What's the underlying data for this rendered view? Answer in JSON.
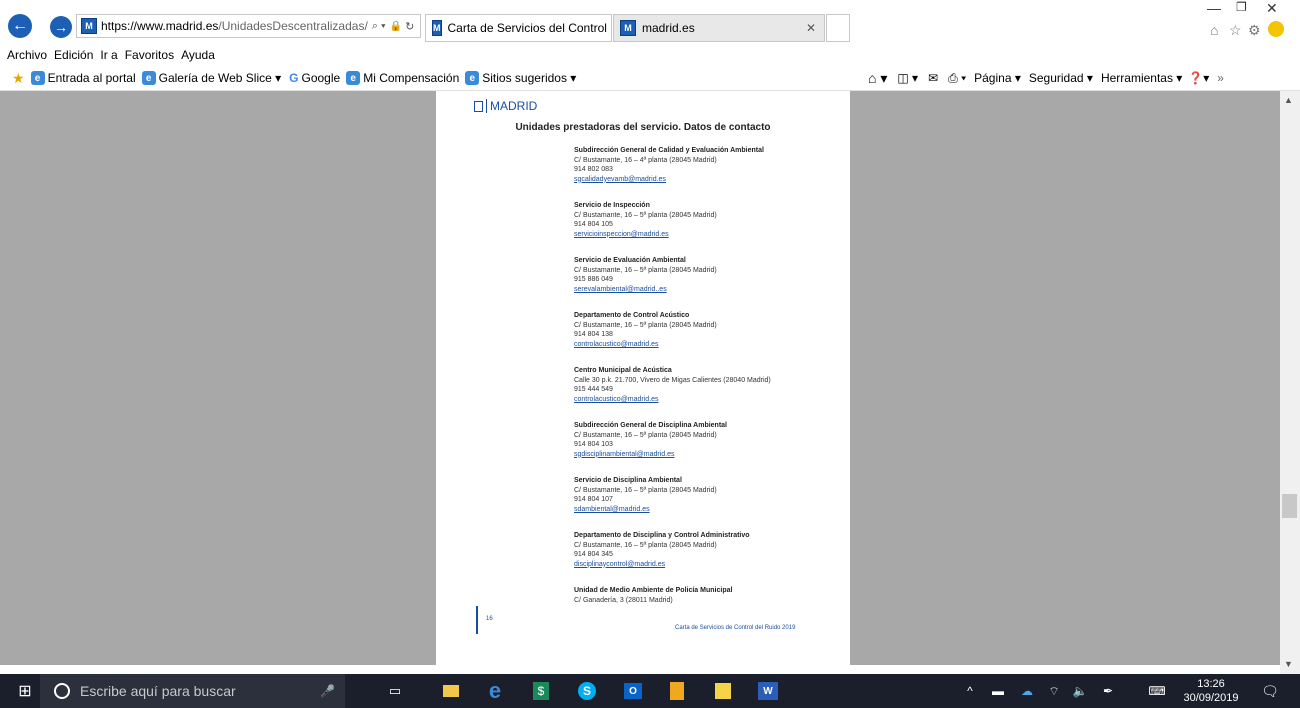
{
  "browser": {
    "url_host": "https://www.madrid.es",
    "url_path": "/UnidadesDescentralizadas/",
    "tabs": [
      {
        "label": "Carta de Servicios del Control ..."
      },
      {
        "label": "madrid.es"
      }
    ],
    "favicon_letter": "M"
  },
  "menu": [
    "Archivo",
    "Edición",
    "Ir a",
    "Favoritos",
    "Ayuda"
  ],
  "favorites": [
    {
      "label": "Entrada al portal"
    },
    {
      "label": "Galería de Web Slice ▾"
    },
    {
      "label": "Google"
    },
    {
      "label": "Mi Compensación"
    },
    {
      "label": "Sitios sugeridos ▾"
    }
  ],
  "commandbar": {
    "page": "Página ▾",
    "security": "Seguridad ▾",
    "tools": "Herramientas ▾"
  },
  "document": {
    "logo": "MADRID",
    "heading": "Unidades prestadoras del servicio. Datos de contacto",
    "entries": [
      {
        "title": "Subdirección General de Calidad y Evaluación Ambiental",
        "address": "C/ Bustamante, 16 – 4ª planta (28045 Madrid)",
        "phone": "914 802 083",
        "email": "sgcalidadyevamb@madrid.es"
      },
      {
        "title": "Servicio de Inspección",
        "address": "C/ Bustamante, 16 – 5ª planta (28045 Madrid)",
        "phone": "914 804 105",
        "email": "servicioinspeccion@madrid.es"
      },
      {
        "title": "Servicio de Evaluación Ambiental",
        "address": "C/ Bustamante, 16 – 5ª planta (28045 Madrid)",
        "phone": "915 886 049",
        "email": "serevalambiental@madrid..es"
      },
      {
        "title": "Departamento de Control Acústico",
        "address": "C/ Bustamante, 16 – 5ª planta (28045 Madrid)",
        "phone": "914 804 138",
        "email": "controlacustico@madrid.es"
      },
      {
        "title": "Centro Municipal de Acústica",
        "address": "Calle 30  p.k. 21.700, Vivero de Migas Calientes (28040 Madrid)",
        "phone": "915 444 549",
        "email": "controlacustico@madrid.es"
      },
      {
        "title": "Subdirección General de Disciplina Ambiental",
        "address": "C/ Bustamante, 16 – 5ª planta (28045 Madrid)",
        "phone": "914 804 103",
        "email": "sgdisciplinambiental@madrid.es"
      },
      {
        "title": "Servicio de Disciplina Ambiental",
        "address": "C/ Bustamante, 16 – 5ª planta (28045 Madrid)",
        "phone": "914 804 107",
        "email": "sdambiental@madrid.es"
      },
      {
        "title": "Departamento de Disciplina y Control Administrativo",
        "address": "C/ Bustamante, 16 – 5ª planta (28045 Madrid)",
        "phone": "914 804 345",
        "email": "disciplinaycontrol@madrid.es"
      },
      {
        "title": "Unidad de Medio Ambiente de Policía Municipal",
        "address": "C/ Ganadería, 3 (28011 Madrid)",
        "phone": "",
        "email": ""
      }
    ],
    "page_number": "16",
    "footer": "Carta de Servicios de Control del Ruido 2019"
  },
  "taskbar": {
    "search_placeholder": "Escribe aquí para buscar",
    "time": "13:26",
    "date": "30/09/2019"
  },
  "colors": {
    "accent": "#1c5fb5",
    "viewport_bg": "#a8a8a8",
    "taskbar_bg": "#1a1f2b"
  }
}
